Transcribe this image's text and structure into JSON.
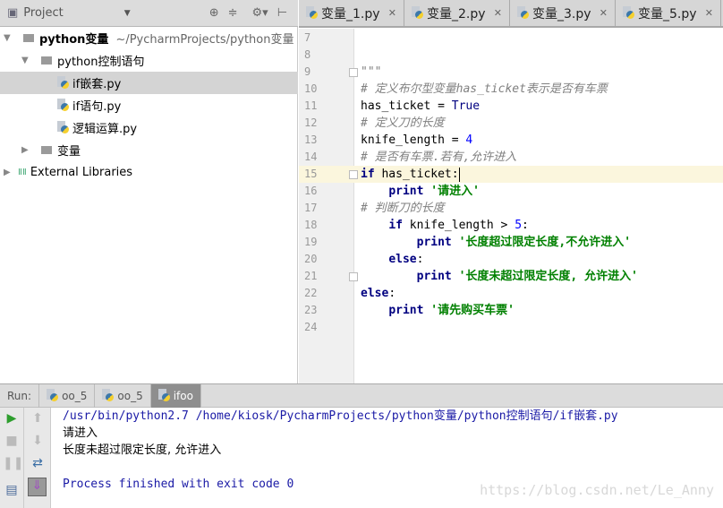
{
  "project_panel": {
    "title": "Project",
    "tree": [
      {
        "label": "python变量",
        "path": "~/PycharmProjects/python变量",
        "type": "folder",
        "level": 0,
        "expanded": true
      },
      {
        "label": "python控制语句",
        "type": "folder",
        "level": 1,
        "expanded": true
      },
      {
        "label": "if嵌套.py",
        "type": "py",
        "level": 2,
        "selected": true
      },
      {
        "label": "if语句.py",
        "type": "py",
        "level": 2
      },
      {
        "label": "逻辑运算.py",
        "type": "py",
        "level": 2
      },
      {
        "label": "变量",
        "type": "folder",
        "level": 1,
        "expanded": false
      },
      {
        "label": "External Libraries",
        "type": "lib",
        "level": 0,
        "expanded": false
      }
    ]
  },
  "editor_tabs": [
    "变量_1.py",
    "变量_2.py",
    "变量_3.py",
    "变量_5.py"
  ],
  "editor": {
    "first_line": 7,
    "current_line": 15,
    "lines": [
      [],
      [],
      [
        [
          "\"\"\"",
          "cm"
        ]
      ],
      [
        [
          "# 定义布尔型变量has_ticket表示是否有车票",
          "cm"
        ]
      ],
      [
        [
          "has_ticket = ",
          ""
        ],
        [
          "True",
          "kw2"
        ]
      ],
      [
        [
          "# 定义刀的长度",
          "cm"
        ]
      ],
      [
        [
          "knife_length = ",
          ""
        ],
        [
          "4",
          "nu"
        ]
      ],
      [
        [
          "# 是否有车票.若有,允许进入",
          "cm"
        ]
      ],
      [
        [
          "if",
          "kw"
        ],
        [
          " has_ticket:",
          ""
        ]
      ],
      [
        [
          "    ",
          ""
        ],
        [
          "print",
          "kw"
        ],
        [
          " '请进入'",
          "st"
        ]
      ],
      [
        [
          "# 判断刀的长度",
          "cm"
        ]
      ],
      [
        [
          "    ",
          ""
        ],
        [
          "if",
          "kw"
        ],
        [
          " knife_length > ",
          ""
        ],
        [
          "5",
          "nu"
        ],
        [
          ":",
          ""
        ]
      ],
      [
        [
          "        ",
          ""
        ],
        [
          "print",
          "kw"
        ],
        [
          " '长度超过限定长度,不允许进入'",
          "st"
        ]
      ],
      [
        [
          "    ",
          ""
        ],
        [
          "else",
          "kw"
        ],
        [
          ":",
          ""
        ]
      ],
      [
        [
          "        ",
          ""
        ],
        [
          "print",
          "kw"
        ],
        [
          " '长度未超过限定长度, 允许进入'",
          "st"
        ]
      ],
      [
        [
          "else",
          "kw"
        ],
        [
          ":",
          ""
        ]
      ],
      [
        [
          "    ",
          ""
        ],
        [
          "print",
          "kw"
        ],
        [
          " '请先购买车票'",
          "st"
        ]
      ],
      []
    ]
  },
  "run": {
    "label": "Run:",
    "tabs": [
      "oo_5",
      "oo_5",
      "ifoo"
    ],
    "active_tab": 2,
    "output": [
      {
        "text": "/usr/bin/python2.7 /home/kiosk/PycharmProjects/python变量/python控制语句/if嵌套.py",
        "style": "sys"
      },
      {
        "text": "请进入",
        "style": "out"
      },
      {
        "text": "长度未超过限定长度, 允许进入",
        "style": "out"
      },
      {
        "text": "",
        "style": "out"
      },
      {
        "text": "Process finished with exit code 0",
        "style": "sys"
      }
    ]
  },
  "watermark": "https://blog.csdn.net/Le_Anny"
}
